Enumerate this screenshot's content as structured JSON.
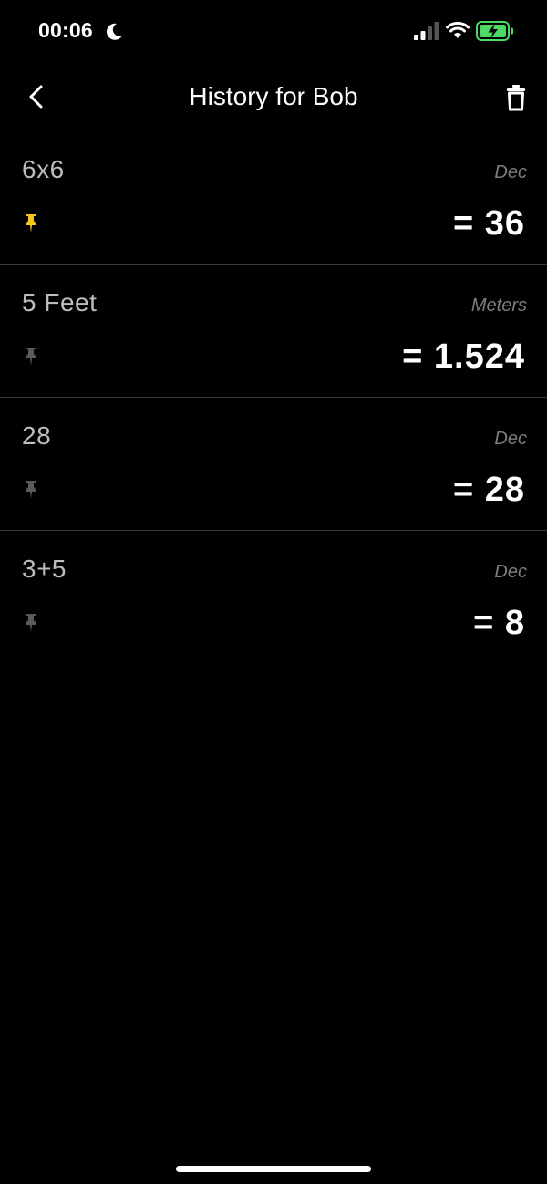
{
  "status_bar": {
    "time": "00:06",
    "icons": [
      "moon-icon",
      "cellular-signal-icon",
      "wifi-icon",
      "battery-charging-icon"
    ],
    "battery_color": "#4cd964"
  },
  "nav": {
    "title": "History for Bob",
    "back_icon": "chevron-left-icon",
    "delete_icon": "trash-icon"
  },
  "colors": {
    "background": "#000000",
    "pin_active": "#f5c518",
    "pin_inactive": "#5a5a5a",
    "divider": "#3a3a3c"
  },
  "history": [
    {
      "expression": "6x6",
      "unit": "Dec",
      "result": "= 36",
      "pinned": true
    },
    {
      "expression": "5 Feet",
      "unit": "Meters",
      "result": "= 1.524",
      "pinned": false
    },
    {
      "expression": "28",
      "unit": "Dec",
      "result": "= 28",
      "pinned": false
    },
    {
      "expression": "3+5",
      "unit": "Dec",
      "result": "= 8",
      "pinned": false
    }
  ]
}
